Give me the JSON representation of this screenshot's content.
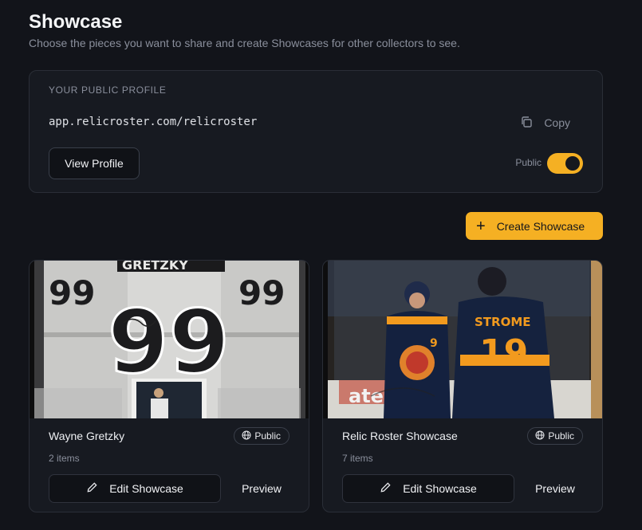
{
  "page": {
    "title": "Showcase",
    "subtitle": "Choose the pieces you want to share and create Showcases for other collectors to see."
  },
  "profile": {
    "heading": "YOUR PUBLIC PROFILE",
    "url": "app.relicroster.com/relicroster",
    "copy_label": "Copy",
    "view_button": "View Profile",
    "visibility_label": "Public",
    "toggle_on": true,
    "accent_color": "#f5b023"
  },
  "actions": {
    "create_label": "Create Showcase"
  },
  "showcases": [
    {
      "title": "Wayne Gretzky",
      "count": "2 items",
      "visibility": "Public",
      "edit_label": "Edit Showcase",
      "preview_label": "Preview",
      "image": {
        "jersey_number": "99",
        "nameplate": "GRETZKY"
      }
    },
    {
      "title": "Relic Roster Showcase",
      "count": "7 items",
      "visibility": "Public",
      "edit_label": "Edit Showcase",
      "preview_label": "Preview",
      "image": {
        "jersey_number": "19",
        "nameplate": "STROME",
        "ad_board": "ate"
      }
    }
  ]
}
